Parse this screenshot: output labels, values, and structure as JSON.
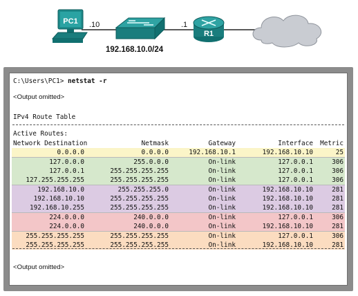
{
  "topology": {
    "pc_label": "PC1",
    "pc_suffix": ".10",
    "router_label": "R1",
    "router_suffix": ".1",
    "network": "192.168.10.0/24"
  },
  "terminal": {
    "prompt": "C:\\Users\\PC1>",
    "command": "netstat -r",
    "output_omitted_top": "<Output omitted>",
    "table_title": "IPv4 Route Table",
    "active_routes": "Active Routes:",
    "headers": {
      "destination": "Network Destination",
      "netmask": "Netmask",
      "gateway": "Gateway",
      "interface": "Interface",
      "metric": "Metric"
    },
    "rows": [
      {
        "dest": "0.0.0.0",
        "mask": "0.0.0.0",
        "gw": "192.168.10.1",
        "iface": "192.168.10.10",
        "metric": "25",
        "color": "#fbf5c8"
      },
      {
        "dest": "127.0.0.0",
        "mask": "255.0.0.0",
        "gw": "On-link",
        "iface": "127.0.0.1",
        "metric": "306",
        "color": "#d6e8cc"
      },
      {
        "dest": "127.0.0.1",
        "mask": "255.255.255.255",
        "gw": "On-link",
        "iface": "127.0.0.1",
        "metric": "306",
        "color": "#d6e8cc"
      },
      {
        "dest": "127.255.255.255",
        "mask": "255.255.255.255",
        "gw": "On-link",
        "iface": "127.0.0.1",
        "metric": "306",
        "color": "#d6e8cc"
      },
      {
        "dest": "192.168.10.0",
        "mask": "255.255.255.0",
        "gw": "On-link",
        "iface": "192.168.10.10",
        "metric": "281",
        "color": "#dccbe3"
      },
      {
        "dest": "192.168.10.10",
        "mask": "255.255.255.255",
        "gw": "On-link",
        "iface": "192.168.10.10",
        "metric": "281",
        "color": "#dccbe3"
      },
      {
        "dest": "192.168.10.255",
        "mask": "255.255.255.255",
        "gw": "On-link",
        "iface": "192.168.10.10",
        "metric": "281",
        "color": "#dccbe3"
      },
      {
        "dest": "224.0.0.0",
        "mask": "240.0.0.0",
        "gw": "On-link",
        "iface": "127.0.0.1",
        "metric": "306",
        "color": "#f3c6c8"
      },
      {
        "dest": "224.0.0.0",
        "mask": "240.0.0.0",
        "gw": "On-link",
        "iface": "192.168.10.10",
        "metric": "281",
        "color": "#f3c6c8"
      },
      {
        "dest": "255.255.255.255",
        "mask": "255.255.255.255",
        "gw": "On-link",
        "iface": "127.0.0.1",
        "metric": "306",
        "color": "#fbdcc0"
      },
      {
        "dest": "255.255.255.255",
        "mask": "255.255.255.255",
        "gw": "On-link",
        "iface": "192.168.10.10",
        "metric": "281",
        "color": "#fbdcc0"
      }
    ],
    "output_omitted_bottom": "<Output omitted>"
  }
}
